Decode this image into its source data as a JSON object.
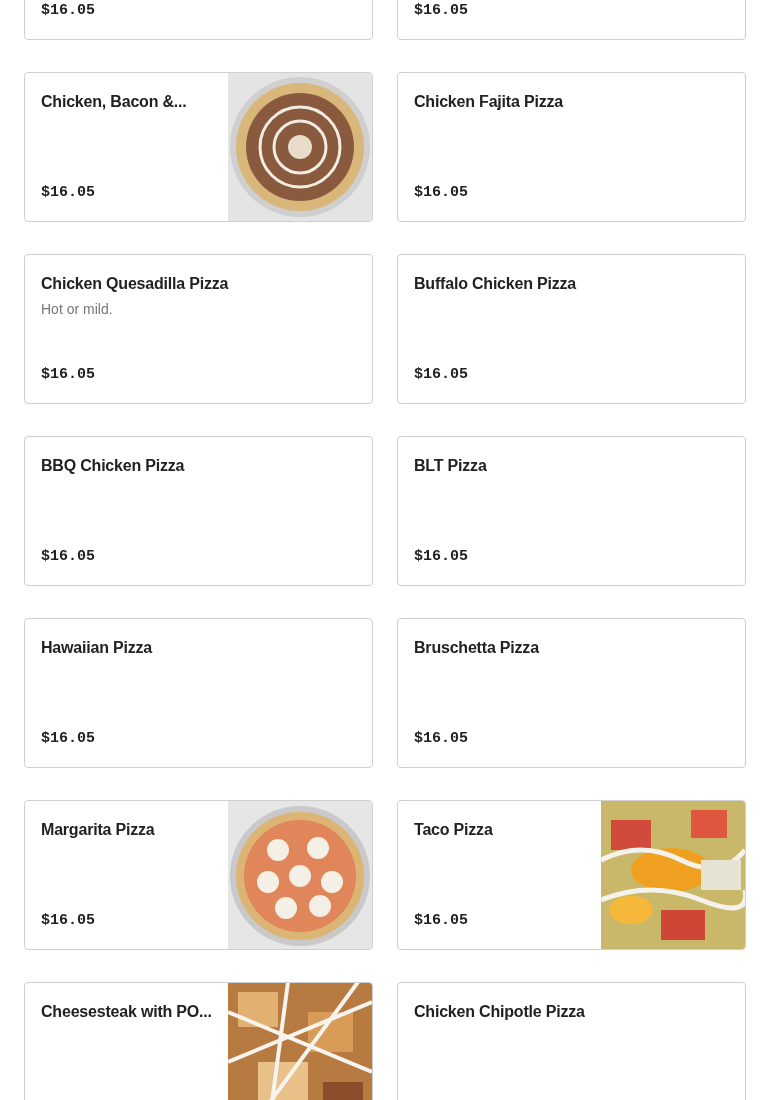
{
  "menu_items": [
    {
      "price": "$16.05"
    },
    {
      "price": "$16.05"
    },
    {
      "name": "Chicken, Bacon &...",
      "price": "$16.05"
    },
    {
      "name": "Chicken Fajita Pizza",
      "price": "$16.05"
    },
    {
      "name": "Chicken Quesadilla Pizza",
      "description": "Hot or mild.",
      "price": "$16.05"
    },
    {
      "name": "Buffalo Chicken Pizza",
      "price": "$16.05"
    },
    {
      "name": "BBQ Chicken Pizza",
      "price": "$16.05"
    },
    {
      "name": "BLT Pizza",
      "price": "$16.05"
    },
    {
      "name": "Hawaiian Pizza",
      "price": "$16.05"
    },
    {
      "name": "Bruschetta Pizza",
      "price": "$16.05"
    },
    {
      "name": "Margarita Pizza",
      "price": "$16.05"
    },
    {
      "name": "Taco Pizza",
      "price": "$16.05"
    },
    {
      "name": "Cheesesteak with PO..."
    },
    {
      "name": "Chicken Chipotle Pizza"
    }
  ]
}
